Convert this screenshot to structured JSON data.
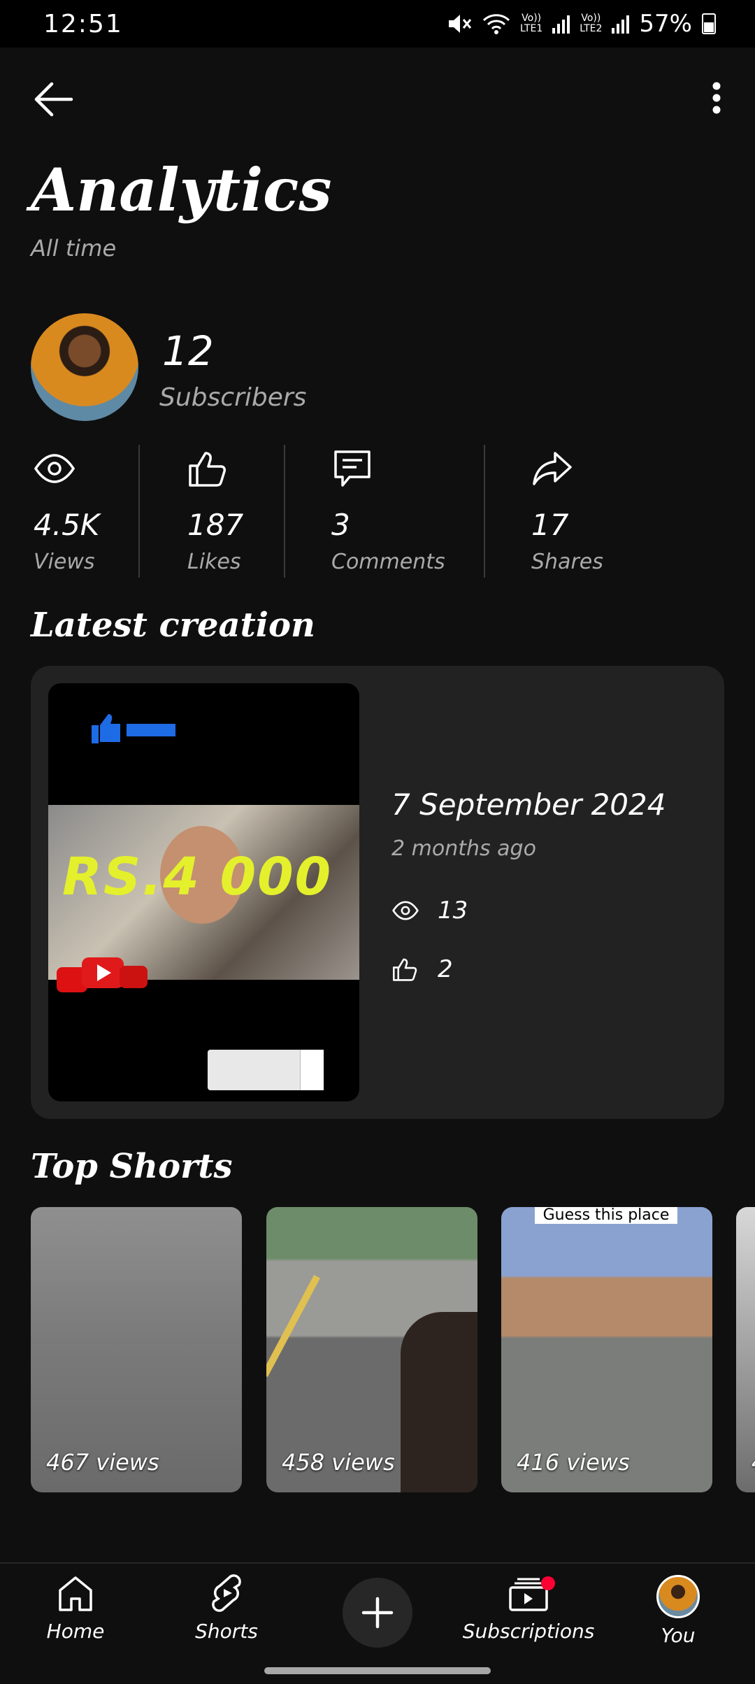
{
  "status_bar": {
    "time": "12:51",
    "net1": "Vo))\nLTE1",
    "net2": "Vo))\nLTE2",
    "battery": "57%"
  },
  "header": {
    "title": "Analytics",
    "subtitle": "All time"
  },
  "channel": {
    "subscriber_count": "12",
    "subscriber_label": "Subscribers"
  },
  "stats": [
    {
      "value": "4.5K",
      "label": "Views",
      "icon": "eye-icon"
    },
    {
      "value": "187",
      "label": "Likes",
      "icon": "thumbs-up-icon"
    },
    {
      "value": "3",
      "label": "Comments",
      "icon": "comment-icon"
    },
    {
      "value": "17",
      "label": "Shares",
      "icon": "share-icon"
    }
  ],
  "latest_creation": {
    "section_title": "Latest creation",
    "date": "7 September 2024",
    "ago": "2 months ago",
    "views": "13",
    "likes": "2",
    "thumbnail_text": "RS.4 000"
  },
  "top_shorts": {
    "section_title": "Top Shorts",
    "items": [
      {
        "views": "467 views"
      },
      {
        "views": "458 views"
      },
      {
        "views": "416 views",
        "overlay": "Guess this place"
      },
      {
        "views": "4"
      }
    ]
  },
  "nav": {
    "home": "Home",
    "shorts": "Shorts",
    "subscriptions": "Subscriptions",
    "you": "You"
  },
  "colors": {
    "background": "#0f0f0f",
    "card": "#222222",
    "notification_dot": "#ff0033"
  }
}
